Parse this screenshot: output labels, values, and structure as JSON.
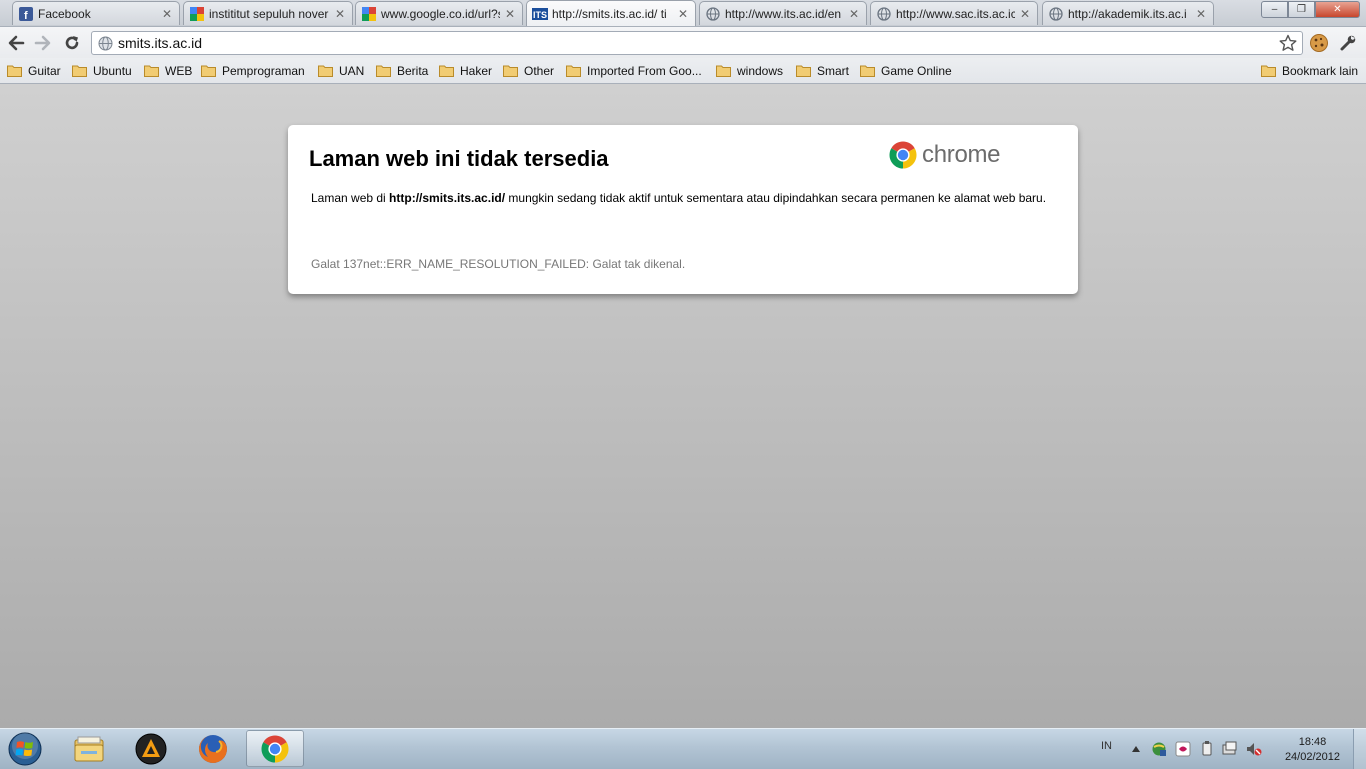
{
  "window": {
    "tabs": [
      {
        "title": "Facebook",
        "icon": "facebook-icon"
      },
      {
        "title": "instititut sepuluh nover",
        "icon": "google-icon"
      },
      {
        "title": "www.google.co.id/url?s",
        "icon": "google-icon"
      },
      {
        "title": "http://smits.its.ac.id/ ti",
        "icon": "its-icon",
        "active": true
      },
      {
        "title": "http://www.its.ac.id/en",
        "icon": "globe-icon"
      },
      {
        "title": "http://www.sac.its.ac.ic",
        "icon": "globe-icon"
      },
      {
        "title": "http://akademik.its.ac.i",
        "icon": "globe-icon"
      }
    ],
    "controls": {
      "minimize": "–",
      "maximize": "❐",
      "close": "✕"
    }
  },
  "toolbar": {
    "url": "smits.its.ac.id"
  },
  "bookmarks": {
    "items": [
      "Guitar",
      "Ubuntu",
      "WEB",
      "Pemprograman",
      "UAN",
      "Berita",
      "Haker",
      "Other",
      "Imported From Goo...",
      "windows",
      "Smart",
      "Game Online"
    ],
    "other_label": "Bookmark lain"
  },
  "error_page": {
    "title": "Laman web ini tidak tersedia",
    "logo_word": "chrome",
    "message_prefix": "Laman web di ",
    "message_url": "http://smits.its.ac.id/",
    "message_suffix": " mungkin sedang tidak aktif untuk sementara atau dipindahkan secara permanen ke alamat web baru.",
    "error_code": "Galat 137net::ERR_NAME_RESOLUTION_FAILED: Galat tak dikenal."
  },
  "taskbar": {
    "language": "IN",
    "time": "18:48",
    "date": "24/02/2012"
  },
  "colors": {
    "chrome_red": "#db4437",
    "chrome_green": "#0f9d58",
    "chrome_yellow": "#f4c20d",
    "chrome_blue": "#4285f4"
  }
}
